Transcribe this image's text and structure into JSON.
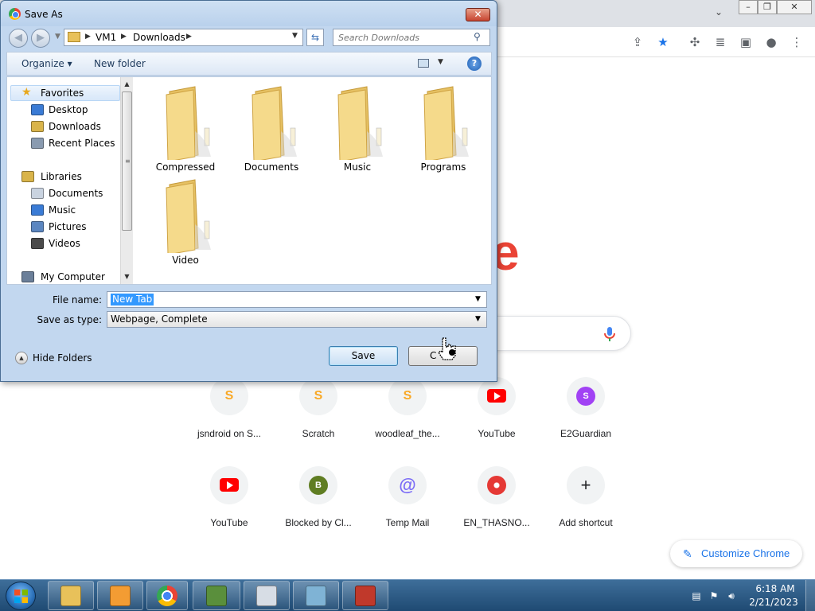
{
  "dialog": {
    "title": "Save As",
    "close_glyph": "✕",
    "nav": {
      "back_glyph": "◀",
      "forward_glyph": "▶",
      "breadcrumbs": [
        "VM1",
        "Downloads"
      ],
      "search_placeholder": "Search Downloads"
    },
    "commands": {
      "organize": "Organize ▾",
      "new_folder": "New folder",
      "help_glyph": "?"
    },
    "nav_pane": {
      "items": [
        {
          "label": "Favorites",
          "icon": "star-icon"
        },
        {
          "label": "Desktop",
          "icon": "desktop-icon"
        },
        {
          "label": "Downloads",
          "icon": "downloads-folder-icon"
        },
        {
          "label": "Recent Places",
          "icon": "recent-places-icon"
        },
        {
          "label": "Libraries",
          "icon": "libraries-icon"
        },
        {
          "label": "Documents",
          "icon": "documents-icon"
        },
        {
          "label": "Music",
          "icon": "music-icon"
        },
        {
          "label": "Pictures",
          "icon": "pictures-icon"
        },
        {
          "label": "Videos",
          "icon": "videos-icon"
        },
        {
          "label": "My Computer",
          "icon": "computer-icon"
        }
      ]
    },
    "folders": [
      "Compressed",
      "Documents",
      "Music",
      "Programs",
      "Video"
    ],
    "form": {
      "file_name_label": "File name:",
      "file_name_value": "New Tab",
      "save_type_label": "Save as type:",
      "save_type_value": "Webpage, Complete"
    },
    "hide_folders_label": "Hide Folders",
    "save_label": "Save",
    "cancel_label": "C"
  },
  "chrome": {
    "shortcuts": [
      {
        "label": "jsndroid on S...",
        "icon": "scratch-icon",
        "glyph": "S",
        "color": "#f9a825"
      },
      {
        "label": "Scratch",
        "icon": "scratch-icon",
        "glyph": "S",
        "color": "#f9a825"
      },
      {
        "label": "woodleaf_the...",
        "icon": "scratch-icon",
        "glyph": "S",
        "color": "#f9a825"
      },
      {
        "label": "YouTube",
        "icon": "youtube-icon",
        "glyph": "",
        "color": "#ff0000"
      },
      {
        "label": "E2Guardian",
        "icon": "letter-s-avatar-icon",
        "glyph": "S",
        "color": "#a142f4"
      },
      {
        "label": "YouTube",
        "icon": "youtube-icon",
        "glyph": "",
        "color": "#ff0000"
      },
      {
        "label": "Blocked by Cl...",
        "icon": "letter-b-avatar-icon",
        "glyph": "B",
        "color": "#5f7d22"
      },
      {
        "label": "Temp Mail",
        "icon": "at-sign-icon",
        "glyph": "@",
        "color": "#7b6cf6"
      },
      {
        "label": "EN_THASNO...",
        "icon": "site-logo-icon",
        "glyph": "",
        "color": "#e53935"
      },
      {
        "label": "Add shortcut",
        "icon": "plus-icon",
        "glyph": "+",
        "color": "#202124"
      }
    ],
    "customize_label": "Customize Chrome",
    "logo_fragment": "e"
  },
  "taskbar": {
    "apps": [
      {
        "name": "explorer",
        "icon": "folder-icon"
      },
      {
        "name": "media-player",
        "icon": "media-player-icon"
      },
      {
        "name": "chrome",
        "icon": "chrome-icon"
      },
      {
        "name": "csharp",
        "icon": "csharp-icon"
      },
      {
        "name": "solitaire",
        "icon": "solitaire-icon"
      },
      {
        "name": "notes",
        "icon": "notepad-icon"
      },
      {
        "name": "snipping-tool",
        "icon": "scissors-icon"
      }
    ],
    "clock_time": "6:18 AM",
    "clock_date": "2/21/2023"
  },
  "colors": {
    "accent_blue": "#1a73e8",
    "selection": "#3399ff",
    "folder_yellow": "#f2d27a"
  }
}
